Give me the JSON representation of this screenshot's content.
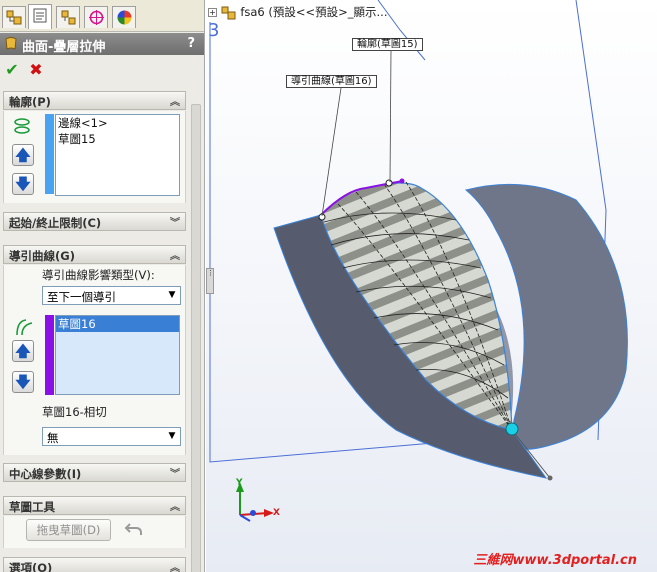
{
  "tabs": [
    {
      "icon": "feature-manager-icon"
    },
    {
      "icon": "property-manager-icon"
    },
    {
      "icon": "configuration-manager-icon"
    },
    {
      "icon": "dimxpert-icon"
    },
    {
      "icon": "display-manager-icon"
    }
  ],
  "header": {
    "title": "曲面-疊層拉伸",
    "help": "?"
  },
  "actions": {
    "ok": "✔",
    "cancel": "✖"
  },
  "profiles": {
    "title": "輪廓(P)",
    "items": [
      "邊線<1>",
      "草圖15"
    ],
    "color": "#4aa3f0"
  },
  "constraints": {
    "title": "起始/終止限制(C)"
  },
  "guides": {
    "title": "導引曲線(G)",
    "influence_label": "導引曲線影響類型(V):",
    "influence_value": "至下一個導引",
    "items": [
      "草圖16"
    ],
    "color": "#8a10e6",
    "tangency_label": "草圖16-相切",
    "tangency_value": "無"
  },
  "centerline": {
    "title": "中心線參數(I)"
  },
  "sketch_tools": {
    "title": "草圖工具",
    "drag_sketch": "拖曳草圖(D)"
  },
  "options": {
    "title": "選項(O)"
  },
  "viewport": {
    "tree_label": "fsa6 (預設<<預設>_顯示...",
    "expand": "+",
    "callout_profile": "輪廓(草圖15)",
    "callout_guide": "導引曲線(草圖16)",
    "axis_x": "X",
    "axis_y": "Y",
    "watermark": "三維网www.3dportal.cn"
  }
}
